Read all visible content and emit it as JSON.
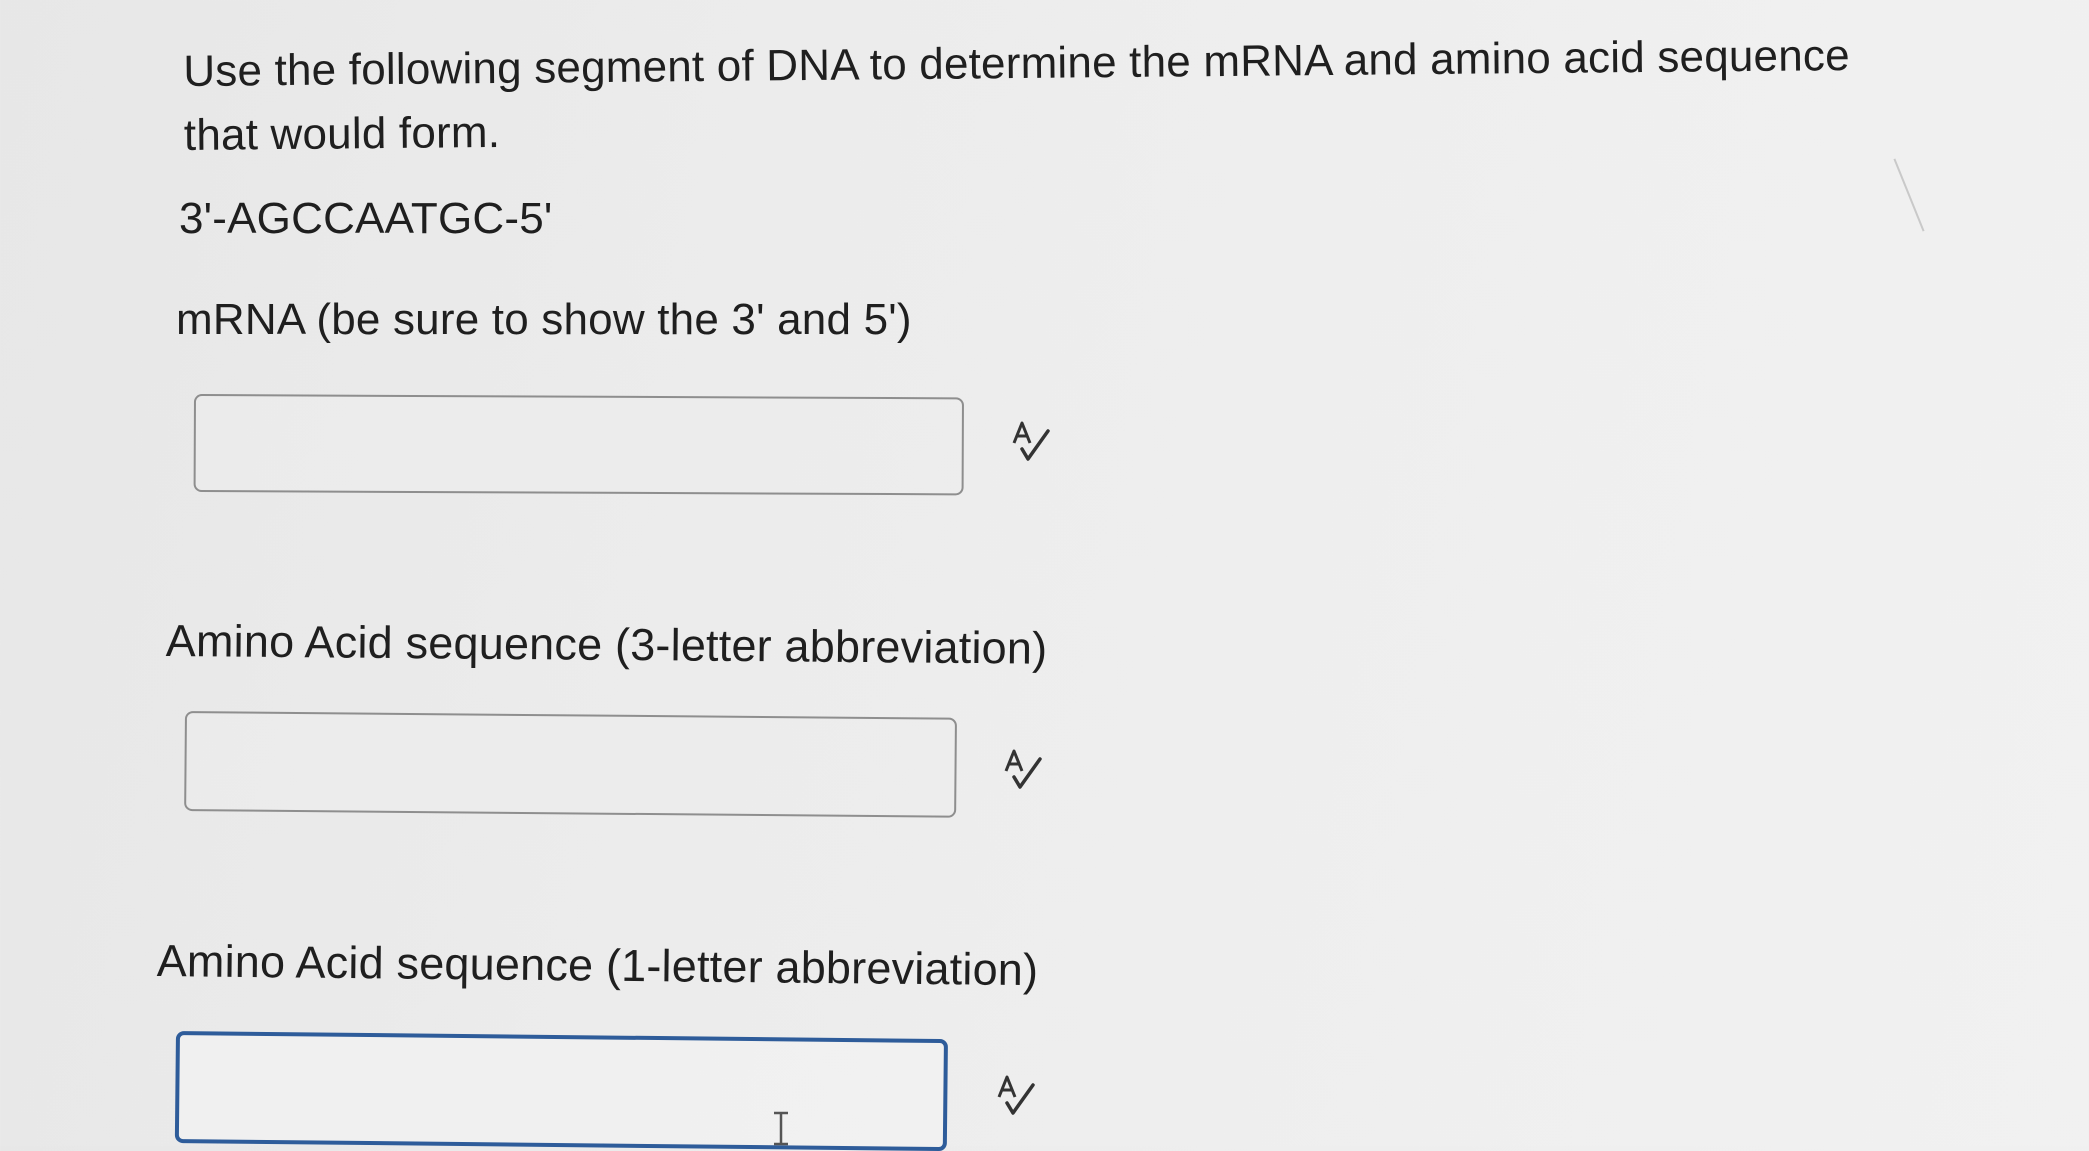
{
  "question": {
    "line1": "Use the following segment of DNA to determine the mRNA and amino acid sequence",
    "line2": "that would form.",
    "dna_sequence": "3'-AGCCAATGC-5'"
  },
  "fields": [
    {
      "label": "mRNA (be sure to show the 3' and 5')",
      "value": "",
      "icon": "spellcheck-icon"
    },
    {
      "label": "Amino Acid sequence (3-letter abbreviation)",
      "value": "",
      "icon": "spellcheck-icon"
    },
    {
      "label": "Amino Acid sequence (1-letter abbreviation)",
      "value": "",
      "icon": "spellcheck-icon",
      "focused": true
    }
  ],
  "colors": {
    "background": "#ececec",
    "text": "#1f1f1f",
    "box_border": "#8e8e8e",
    "focus_border": "#2e5c9a"
  }
}
